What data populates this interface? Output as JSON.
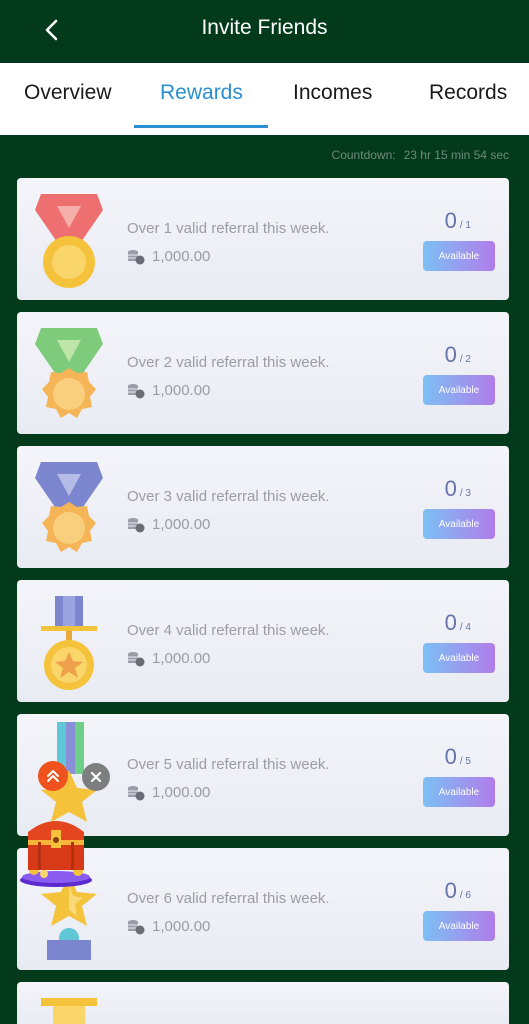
{
  "header": {
    "title": "Invite Friends"
  },
  "tabs": [
    {
      "label": "Overview"
    },
    {
      "label": "Rewards"
    },
    {
      "label": "Incomes"
    },
    {
      "label": "Records"
    }
  ],
  "countdown": {
    "label": "Countdown:",
    "value": "23 hr 15 min 54 sec"
  },
  "rewards": [
    {
      "description": "Over 1 valid referral this week.",
      "amount": "1,000.00",
      "current": "0",
      "target": "/ 1",
      "button": "Available",
      "medal": "red-ribbon-medal-icon"
    },
    {
      "description": "Over 2 valid referral this week.",
      "amount": "1,000.00",
      "current": "0",
      "target": "/ 2",
      "button": "Available",
      "medal": "green-ribbon-medal-icon"
    },
    {
      "description": "Over 3 valid referral this week.",
      "amount": "1,000.00",
      "current": "0",
      "target": "/ 3",
      "button": "Available",
      "medal": "blue-ribbon-medal-icon"
    },
    {
      "description": "Over 4 valid referral this week.",
      "amount": "1,000.00",
      "current": "0",
      "target": "/ 4",
      "button": "Available",
      "medal": "star-medal-icon"
    },
    {
      "description": "Over 5 valid referral this week.",
      "amount": "1,000.00",
      "current": "0",
      "target": "/ 5",
      "button": "Available",
      "medal": "star-ribbon-medal-icon"
    },
    {
      "description": "Over 6 valid referral this week.",
      "amount": "1,000.00",
      "current": "0",
      "target": "/ 6",
      "button": "Available",
      "medal": "trophy-star-icon"
    }
  ],
  "colors": {
    "header_bg": "#033a1c",
    "tab_active": "#2a8fd0",
    "button_gradient_start": "#7cc0f4",
    "button_gradient_end": "#b07cea"
  }
}
